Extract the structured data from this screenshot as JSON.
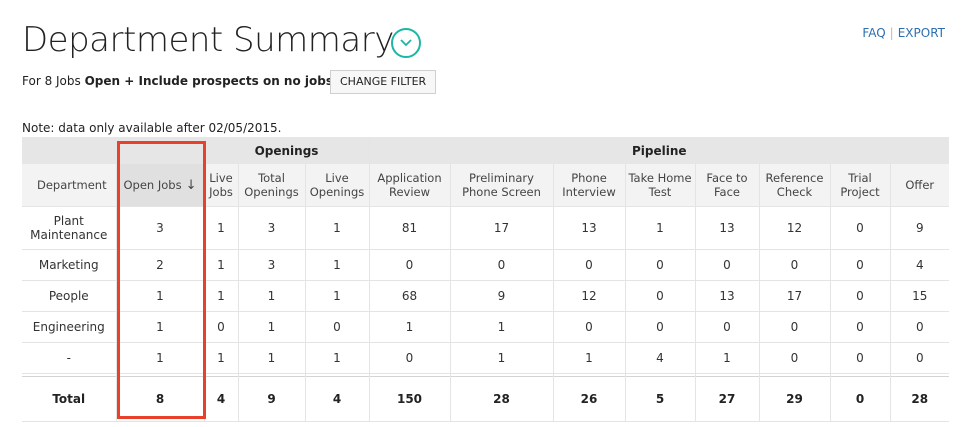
{
  "header": {
    "title": "Department Summary",
    "faq_label": "FAQ",
    "export_label": "EXPORT"
  },
  "filter": {
    "prefix": "For 8 Jobs ",
    "open_label": "Open",
    "plus": " + ",
    "include_label": "Include prospects on no jobs",
    "change_button": "CHANGE FILTER"
  },
  "note": "Note: data only available after 02/05/2015.",
  "table": {
    "groups": {
      "openings": "Openings",
      "pipeline": "Pipeline"
    },
    "columns": [
      "Department",
      "Open Jobs",
      "Live Jobs",
      "Total Openings",
      "Live Openings",
      "Application Review",
      "Preliminary Phone Screen",
      "Phone Interview",
      "Take Home Test",
      "Face to Face",
      "Reference Check",
      "Trial Project",
      "Offer"
    ],
    "sort_arrow": "↓",
    "rows": [
      [
        "Plant Maintenance",
        "3",
        "1",
        "3",
        "1",
        "81",
        "17",
        "13",
        "1",
        "13",
        "12",
        "0",
        "9"
      ],
      [
        "Marketing",
        "2",
        "1",
        "3",
        "1",
        "0",
        "0",
        "0",
        "0",
        "0",
        "0",
        "0",
        "4"
      ],
      [
        "People",
        "1",
        "1",
        "1",
        "1",
        "68",
        "9",
        "12",
        "0",
        "13",
        "17",
        "0",
        "15"
      ],
      [
        "Engineering",
        "1",
        "0",
        "1",
        "0",
        "1",
        "1",
        "0",
        "0",
        "0",
        "0",
        "0",
        "0"
      ],
      [
        "-",
        "1",
        "1",
        "1",
        "1",
        "0",
        "1",
        "1",
        "4",
        "1",
        "0",
        "0",
        "0"
      ]
    ],
    "total": [
      "Total",
      "8",
      "4",
      "9",
      "4",
      "150",
      "28",
      "26",
      "5",
      "27",
      "29",
      "0",
      "28"
    ]
  },
  "colors": {
    "accent": "#1ab7a6",
    "link": "#2d6fb0",
    "highlight_box": "#e8402a"
  },
  "icons": {
    "title_toggle": "chevron-down-circle-icon",
    "sort": "arrow-down-icon"
  }
}
